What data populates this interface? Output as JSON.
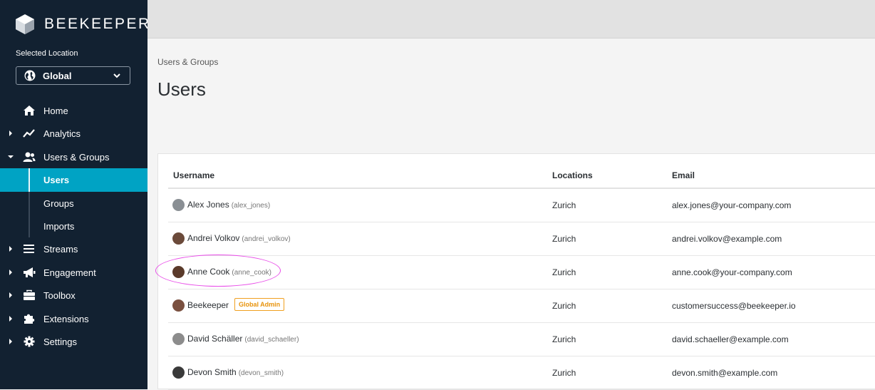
{
  "brand": {
    "name": "BEEKEEPER"
  },
  "location": {
    "label": "Selected Location",
    "value": "Global"
  },
  "sidebar": {
    "items": [
      {
        "label": "Home",
        "icon": "home-icon",
        "caret": ""
      },
      {
        "label": "Analytics",
        "icon": "analytics-icon",
        "caret": "right"
      },
      {
        "label": "Users & Groups",
        "icon": "users-icon",
        "caret": "down"
      },
      {
        "label": "Users",
        "sub": true,
        "active": true
      },
      {
        "label": "Groups",
        "sub": true
      },
      {
        "label": "Imports",
        "sub": true
      },
      {
        "label": "Streams",
        "icon": "streams-icon",
        "caret": "right"
      },
      {
        "label": "Engagement",
        "icon": "megaphone-icon",
        "caret": "right"
      },
      {
        "label": "Toolbox",
        "icon": "toolbox-icon",
        "caret": "right"
      },
      {
        "label": "Extensions",
        "icon": "puzzle-icon",
        "caret": "right"
      },
      {
        "label": "Settings",
        "icon": "gear-icon",
        "caret": "right"
      }
    ]
  },
  "header": {
    "breadcrumb": "Users & Groups",
    "title": "Users"
  },
  "table": {
    "columns": [
      "Username",
      "Locations",
      "Email"
    ],
    "rows": [
      {
        "name": "Alex Jones",
        "handle": "(alex_jones)",
        "badge": "",
        "location": "Zurich",
        "email": "alex.jones@your-company.com",
        "avatar_color": "#8a8f94"
      },
      {
        "name": "Andrei Volkov",
        "handle": "(andrei_volkov)",
        "badge": "",
        "location": "Zurich",
        "email": "andrei.volkov@example.com",
        "avatar_color": "#6b4a3a"
      },
      {
        "name": "Anne Cook",
        "handle": "(anne_cook)",
        "badge": "",
        "location": "Zurich",
        "email": "anne.cook@your-company.com",
        "avatar_color": "#5a3a2a"
      },
      {
        "name": "Beekeeper",
        "handle": "",
        "badge": "Global Admin",
        "location": "Zurich",
        "email": "customersuccess@beekeeper.io",
        "avatar_color": "#7a5040"
      },
      {
        "name": "David Schäller",
        "handle": "(david_schaeller)",
        "badge": "",
        "location": "Zurich",
        "email": "david.schaeller@example.com",
        "avatar_color": "#8c8c8c"
      },
      {
        "name": "Devon Smith",
        "handle": "(devon_smith)",
        "badge": "",
        "location": "Zurich",
        "email": "devon.smith@example.com",
        "avatar_color": "#3a3a3a"
      }
    ]
  },
  "colors": {
    "sidebar_bg": "#122131",
    "active_bg": "#00a3c4",
    "badge": "#f0a020",
    "highlight": "#e84be8"
  }
}
